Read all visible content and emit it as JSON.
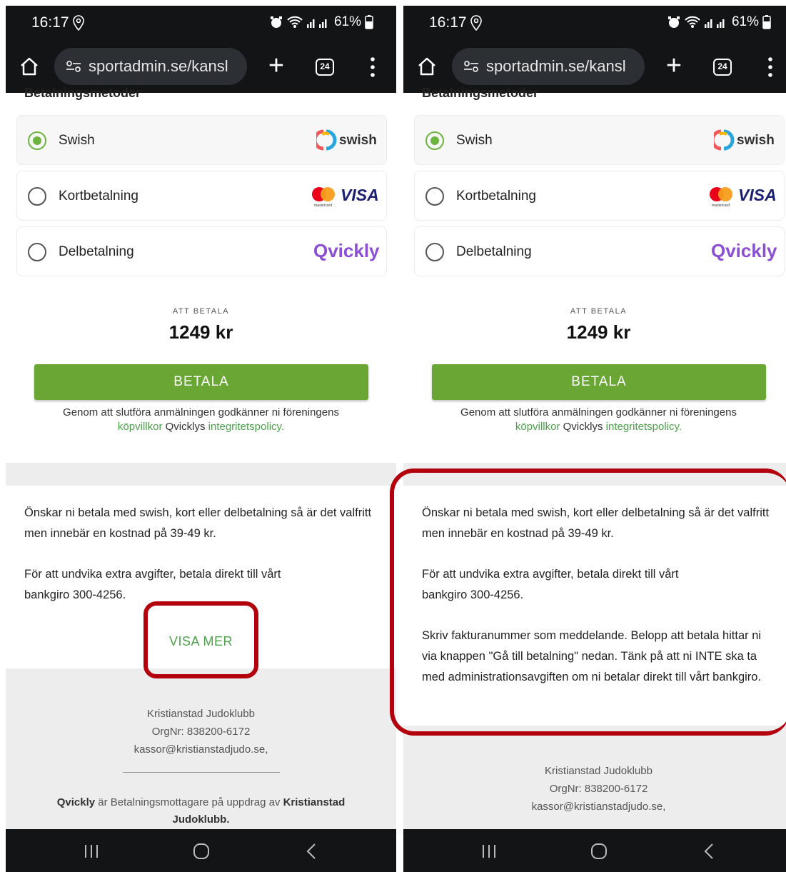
{
  "status": {
    "time": "16:17",
    "battery": "61%"
  },
  "browser": {
    "url": "sportadmin.se/kansl",
    "tab_count": "24"
  },
  "payment": {
    "section_title": "Betalningsmetoder",
    "options": [
      {
        "label": "Swish",
        "selected": true,
        "logo": "swish-logo",
        "logo_text": "swish"
      },
      {
        "label": "Kortbetalning",
        "selected": false,
        "logo": "mastercard-visa-logo",
        "logo_text": "VISA",
        "sub_text": "mastercard"
      },
      {
        "label": "Delbetalning",
        "selected": false,
        "logo": "qvickly-logo",
        "logo_text": "Qvickly"
      }
    ],
    "due_label": "ATT BETALA",
    "due_amount": "1249 kr",
    "pay_button": "BETALA",
    "terms_prefix": "Genom att slutföra anmälningen godkänner ni föreningens",
    "terms_link1": "köpvillkor",
    "terms_mid": "Qvicklys",
    "terms_link2": "integritetspolicy."
  },
  "info": {
    "p1": "Önskar ni betala med swish, kort eller delbetalning så är det valfritt men innebär en kostnad på 39-49 kr.",
    "p2": "För att undvika extra avgifter, betala direkt till vårt bankgiro 300-4256.",
    "p3": "Skriv fakturanummer som meddelande. Belopp att betala hittar ni via knappen \"Gå till betalning\" nedan. Tänk på att ni INTE ska ta med administrationsavgiften om ni betalar direkt till vårt bankgiro.",
    "show_more": "VISA MER"
  },
  "footer": {
    "club": "Kristianstad Judoklubb",
    "orgnr": "OrgNr: 838200-6172",
    "email": "kassor@kristianstadjudo.se,",
    "note_brand": "Qvickly",
    "note_text": "är Betalningsmottagare på uppdrag av",
    "note_club": "Kristianstad Judoklubb."
  },
  "colors": {
    "accent_green": "#6aa634",
    "link_green": "#4ca24a",
    "highlight_red": "#b3000c",
    "bar_dark": "#121416"
  }
}
